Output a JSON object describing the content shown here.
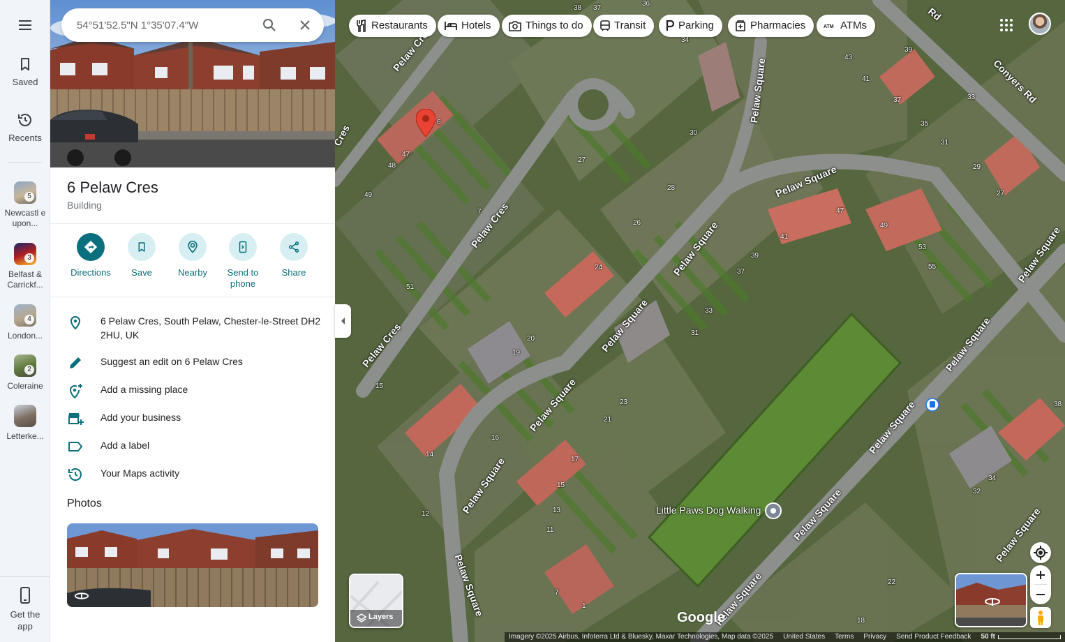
{
  "rail": {
    "saved_label": "Saved",
    "recents_label": "Recents",
    "recent_items": [
      {
        "label": "Newcastl e upon...",
        "count": "5"
      },
      {
        "label": "Belfast & Carrickf...",
        "count": "3"
      },
      {
        "label": "London...",
        "count": "4"
      },
      {
        "label": "Coleraine",
        "count": "2"
      },
      {
        "label": "Letterke...",
        "count": ""
      }
    ],
    "get_app_label": "Get the app"
  },
  "search": {
    "query": "54°51'52.5\"N 1°35'07.4\"W"
  },
  "place": {
    "title": "6 Pelaw Cres",
    "category": "Building",
    "actions": [
      {
        "label": "Directions",
        "icon": "directions-icon"
      },
      {
        "label": "Save",
        "icon": "bookmark-icon"
      },
      {
        "label": "Nearby",
        "icon": "nearby-icon"
      },
      {
        "label": "Send to phone",
        "icon": "send-to-phone-icon"
      },
      {
        "label": "Share",
        "icon": "share-icon"
      }
    ],
    "address": "6 Pelaw Cres, South Pelaw, Chester-le-Street DH2 2HU, UK",
    "suggest_edit": "Suggest an edit on 6 Pelaw Cres",
    "add_missing": "Add a missing place",
    "add_business": "Add your business",
    "add_label": "Add a label",
    "maps_activity": "Your Maps activity",
    "photos_heading": "Photos"
  },
  "map": {
    "chips": [
      {
        "label": "Restaurants",
        "icon": "restaurant-icon"
      },
      {
        "label": "Hotels",
        "icon": "hotel-icon"
      },
      {
        "label": "Things to do",
        "icon": "camera-icon"
      },
      {
        "label": "Transit",
        "icon": "transit-icon"
      },
      {
        "label": "Parking",
        "icon": "parking-icon"
      },
      {
        "label": "Pharmacies",
        "icon": "pharmacy-icon"
      },
      {
        "label": "ATMs",
        "icon": "atm-icon"
      }
    ],
    "road_labels": [
      "Pelaw Cres",
      "Pelaw Cres",
      "Pelaw Cres",
      "Pelaw Square",
      "Pelaw Square",
      "Pelaw Square",
      "Pelaw Square",
      "Pelaw Square",
      "Pelaw Square",
      "Pelaw Square",
      "Pelaw Square",
      "Pelaw Square",
      "Pelaw Square",
      "Pelaw Square",
      "Conyers Rd",
      "Cres",
      "Rd"
    ],
    "house_numbers": [
      "6",
      "47",
      "48",
      "49",
      "51",
      "7",
      "27",
      "28",
      "26",
      "24",
      "20",
      "19",
      "15",
      "16",
      "14",
      "12",
      "13",
      "11",
      "15",
      "21",
      "23",
      "17",
      "7",
      "1",
      "30",
      "33",
      "31",
      "37",
      "39",
      "41",
      "47",
      "49",
      "53",
      "55",
      "43",
      "41",
      "39",
      "37",
      "35",
      "33",
      "31",
      "29",
      "27",
      "38",
      "34",
      "32",
      "22",
      "18",
      "34",
      "36",
      "38",
      "37"
    ],
    "poi_label": "Little Paws Dog Walking",
    "layers_label": "Layers",
    "google_logo": "Google",
    "attribution": {
      "imagery": "Imagery ©2025 Airbus, Infoterra Ltd & Bluesky, Maxar Technologies, Map data ©2025",
      "country": "United States",
      "terms": "Terms",
      "privacy": "Privacy",
      "feedback": "Send Product Feedback",
      "scale": "50 ft"
    }
  },
  "colors": {
    "accent": "#0b6f7d",
    "accent_light": "#d7eff2",
    "pin": "#ea4335"
  }
}
